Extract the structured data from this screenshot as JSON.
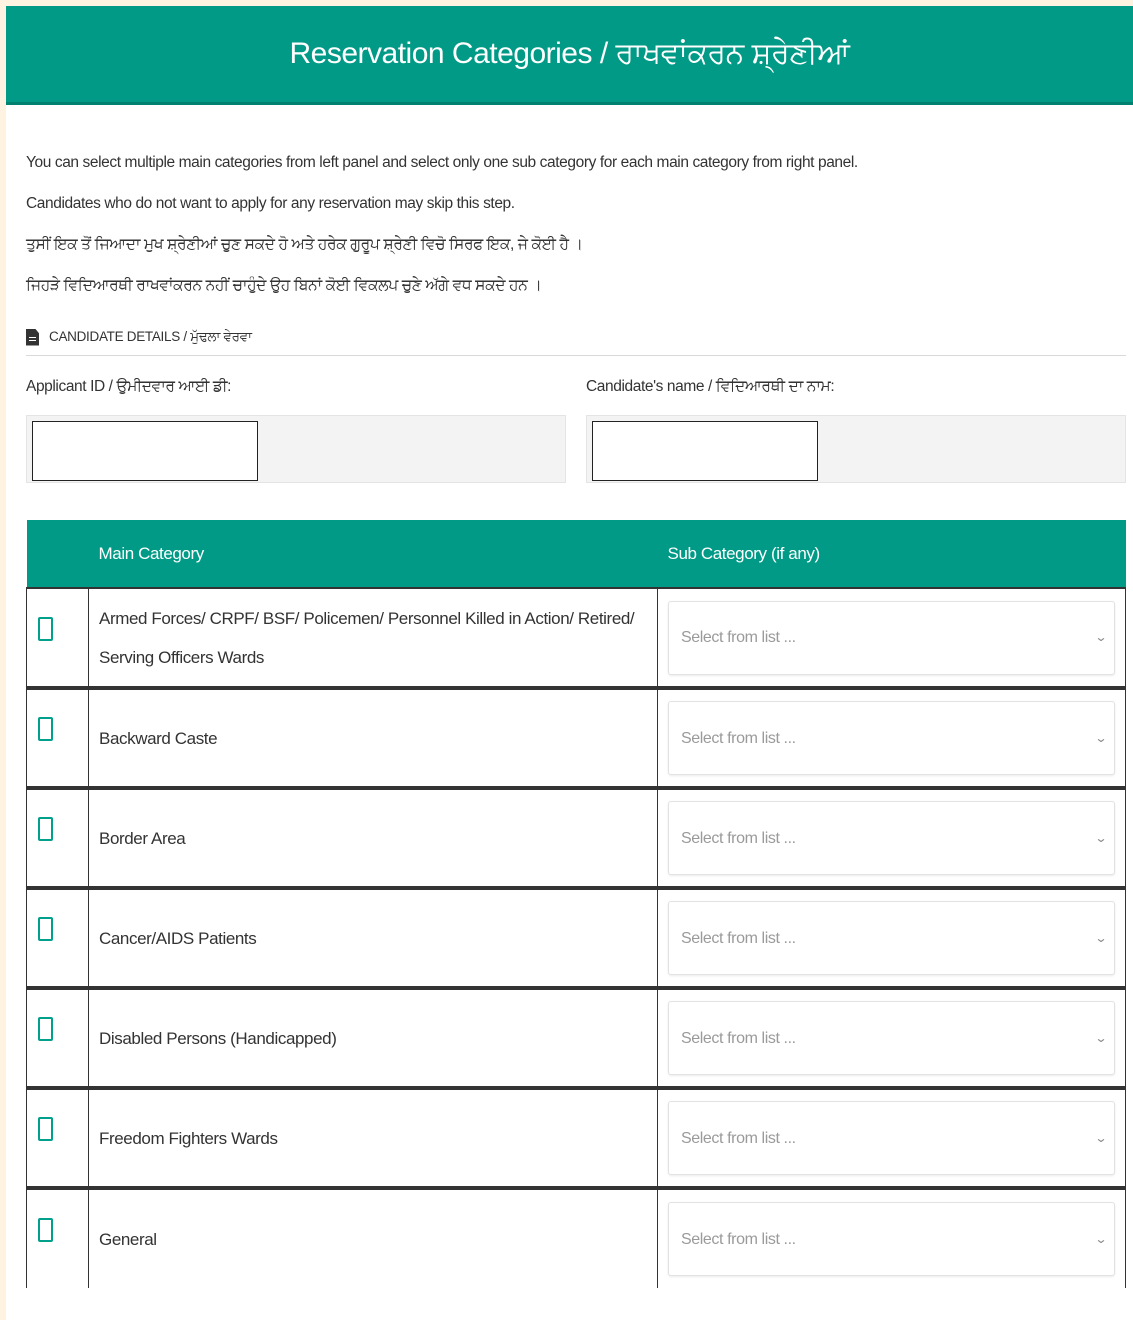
{
  "header": {
    "title": "Reservation Categories / ਰਾਖਵਾਂਕਰਨ ਸ਼੍ਰੇਣੀਆਂ"
  },
  "info": {
    "line1": "You can select multiple main categories from left panel and select only one sub category for each main category from right panel.",
    "line2": "Candidates who do not want to apply for any reservation may skip this step.",
    "line3": "ਤੁਸੀਂ ਇਕ ਤੋਂ ਜਿਆਦਾ ਮੁਖ ਸ਼੍ਰੇਣੀਆਂ ਚੁਣ ਸਕਦੇ ਹੋ ਅਤੇ ਹਰੇਕ ਗੁਰੂਪ ਸ਼੍ਰੇਣੀ ਵਿਚੋ ਸਿਰਫ ਇਕ, ਜੇ ਕੋਈ ਹੈ ।",
    "line4": "ਜਿਹੜੇ ਵਿਦਿਆਰਥੀ ਰਾਖਵਾਂਕਰਨ ਨਹੀਂ ਚਾਹੁੰਦੇ ਉਹ ਬਿਨਾਂ ਕੋਈ ਵਿਕਲਪ ਚੁਣੇ ਅੱਗੇ ਵਧ ਸਕਦੇ ਹਨ ।"
  },
  "candidate": {
    "section_title": "CANDIDATE DETAILS / ਮੁੱਢਲਾ ਵੇਰਵਾ",
    "applicant_id_label": "Applicant ID / ਉਮੀਦਵਾਰ ਆਈ ਡੀ:",
    "applicant_id_value": "",
    "name_label": "Candidate's name / ਵਿਦਿਆਰਥੀ ਦਾ ਨਾਮ:",
    "name_value": ""
  },
  "table": {
    "headers": {
      "main": "Main Category",
      "sub": "Sub Category (if any)"
    },
    "select_placeholder": "Select from list ...",
    "rows": [
      {
        "main": "Armed Forces/ CRPF/ BSF/ Policemen/ Personnel Killed in Action/ Retired/ Serving Officers Wards",
        "checked": false
      },
      {
        "main": "Backward Caste",
        "checked": false
      },
      {
        "main": "Border Area",
        "checked": false
      },
      {
        "main": "Cancer/AIDS Patients",
        "checked": false
      },
      {
        "main": "Disabled Persons (Handicapped)",
        "checked": false
      },
      {
        "main": "Freedom Fighters Wards",
        "checked": false
      },
      {
        "main": "General",
        "checked": false
      }
    ]
  },
  "colors": {
    "primary": "#009a86",
    "page_bg": "#fdf3e0"
  },
  "icons": {
    "section": "document-icon",
    "dropdown": "chevron-down-icon"
  }
}
